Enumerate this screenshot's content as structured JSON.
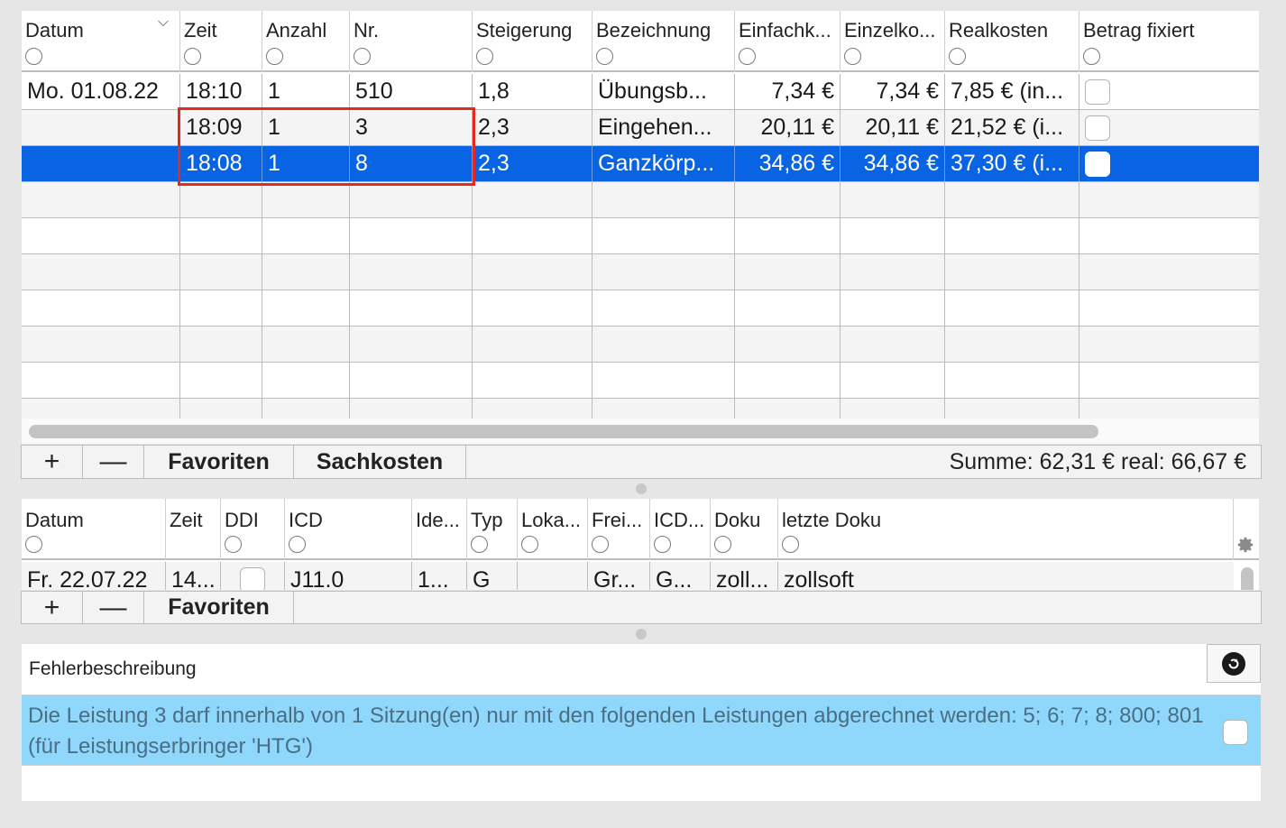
{
  "top_table": {
    "columns": [
      "Datum",
      "Zeit",
      "Anzahl",
      "Nr.",
      "Steigerung",
      "Bezeichnung",
      "Einfachk...",
      "Einzelko...",
      "Realkosten",
      "Betrag fixiert"
    ],
    "rows": [
      {
        "datum": "Mo. 01.08.22",
        "zeit": "18:10",
        "anzahl": "1",
        "nr": "510",
        "steigerung": "1,8",
        "bezeichnung": "Übungsb...",
        "einfach": "7,34 €",
        "einzel": "7,34 €",
        "real": "7,85 € (in...",
        "fixiert": false
      },
      {
        "datum": "",
        "zeit": "18:09",
        "anzahl": "1",
        "nr": "3",
        "steigerung": "2,3",
        "bezeichnung": "Eingehen...",
        "einfach": "20,11 €",
        "einzel": "20,11 €",
        "real": "21,52 € (i...",
        "fixiert": false
      },
      {
        "datum": "",
        "zeit": "18:08",
        "anzahl": "1",
        "nr": "8",
        "steigerung": "2,3",
        "bezeichnung": "Ganzkörp...",
        "einfach": "34,86 €",
        "einzel": "34,86 €",
        "real": "37,30 € (i...",
        "fixiert": false,
        "selected": true
      }
    ],
    "toolbar": {
      "add": "+",
      "remove": "—",
      "favoriten": "Favoriten",
      "sachkosten": "Sachkosten",
      "summe": "Summe: 62,31 € real: 66,67 €"
    }
  },
  "icd_table": {
    "columns": [
      "Datum",
      "Zeit",
      "DDI",
      "ICD",
      "Ide...",
      "Typ",
      "Loka...",
      "Frei...",
      "ICD...",
      "Doku",
      "letzte Doku"
    ],
    "rows": [
      {
        "datum": "Fr. 22.07.22",
        "zeit": "14...",
        "ddi": false,
        "icd": "J11.0",
        "ide": "1...",
        "typ": "G",
        "loka": "",
        "frei": "Gr...",
        "icd2": "G...",
        "doku": "zoll...",
        "letzte": "zollsoft"
      }
    ],
    "toolbar": {
      "add": "+",
      "remove": "—",
      "favoriten": "Favoriten"
    }
  },
  "error_panel": {
    "title": "Fehlerbeschreibung",
    "message": "Die Leistung 3 darf innerhalb von 1 Sitzung(en) nur mit den folgenden Leistungen abgerechnet werden: 5; 6; 7; 8; 800; 801 (für Leistungserbringer 'HTG')"
  },
  "colors": {
    "selection": "#0964e3",
    "error_bg": "#8fd8fb",
    "error_text": "#4a6e84",
    "highlight": "#e02a22"
  }
}
